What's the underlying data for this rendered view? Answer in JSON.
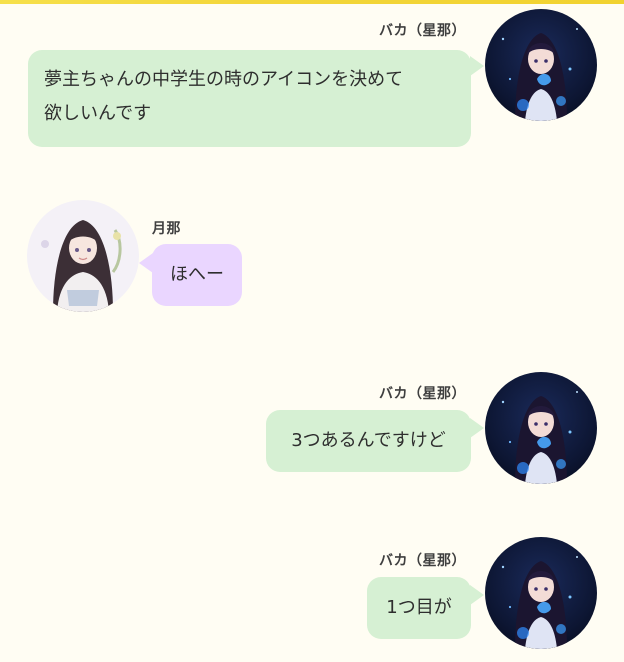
{
  "messages": [
    {
      "sender": "バカ（星那）",
      "side": "right",
      "avatar": "anime-girl-night-avatar-icon",
      "lines": [
        "夢主ちゃんの中学生の時のアイコンを決めて",
        "欲しいんです"
      ]
    },
    {
      "sender": "月那",
      "side": "left",
      "avatar": "anime-girl-light-avatar-icon",
      "lines": [
        "ほへー"
      ]
    },
    {
      "sender": "バカ（星那）",
      "side": "right",
      "avatar": "anime-girl-night-avatar-icon",
      "lines": [
        "3つあるんですけど"
      ]
    },
    {
      "sender": "バカ（星那）",
      "side": "right",
      "avatar": "anime-girl-night-avatar-icon",
      "lines": [
        "1つ目が"
      ]
    }
  ],
  "colors": {
    "background": "#fffdf3",
    "top_bar": "#f3d63a",
    "bubble_self": "#d6f0d3",
    "bubble_other": "#ead6ff"
  }
}
